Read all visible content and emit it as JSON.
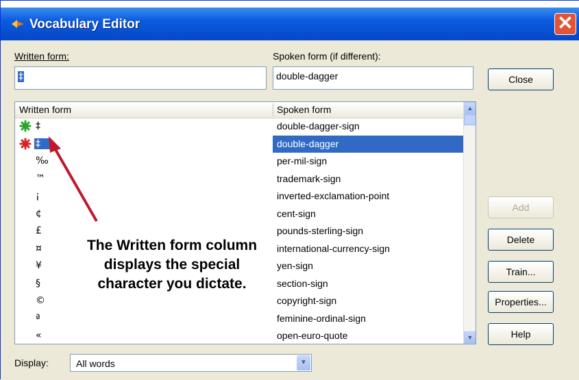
{
  "window": {
    "title": "Vocabulary Editor",
    "close_glyph": "✕"
  },
  "written_field": {
    "label": "Written form:",
    "value": "‡"
  },
  "spoken_field": {
    "label": "Spoken form (if different):",
    "value": "double-dagger"
  },
  "buttons": {
    "close": "Close",
    "add": "Add",
    "delete": "Delete",
    "train": "Train...",
    "properties": "Properties...",
    "help": "Help"
  },
  "list": {
    "headers": {
      "written": "Written form",
      "spoken": "Spoken form"
    },
    "rows": [
      {
        "written": "‡",
        "spoken": "double-dagger-sign",
        "icon": "green-asterisk-icon"
      },
      {
        "written": "‡",
        "spoken": "double-dagger",
        "icon": "red-asterisk-icon",
        "selected": true
      },
      {
        "written": "‰",
        "spoken": "per-mil-sign"
      },
      {
        "written": "™",
        "spoken": "trademark-sign"
      },
      {
        "written": "¡",
        "spoken": "inverted-exclamation-point"
      },
      {
        "written": "¢",
        "spoken": "cent-sign"
      },
      {
        "written": "£",
        "spoken": "pounds-sterling-sign"
      },
      {
        "written": "¤",
        "spoken": "international-currency-sign"
      },
      {
        "written": "¥",
        "spoken": "yen-sign"
      },
      {
        "written": "§",
        "spoken": "section-sign"
      },
      {
        "written": "©",
        "spoken": "copyright-sign"
      },
      {
        "written": "ª",
        "spoken": "feminine-ordinal-sign"
      },
      {
        "written": "«",
        "spoken": "open-euro-quote"
      }
    ]
  },
  "annotation": "The Written form column displays the special character you dictate.",
  "display": {
    "label": "Display:",
    "value": "All words"
  },
  "colors": {
    "selection": "#316ac5",
    "arrow": "#c0182b",
    "titlebar": "#0a5be0"
  }
}
